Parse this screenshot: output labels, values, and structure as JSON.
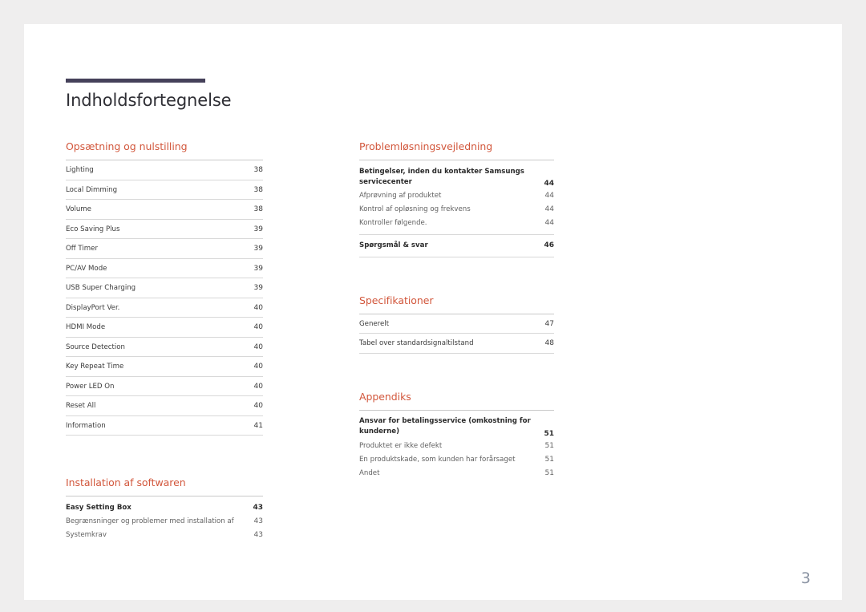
{
  "document": {
    "title": "Indholdsfortegnelse",
    "page_number": "3",
    "accent_color": "#d2573c",
    "rule_color": "#45415a"
  },
  "left_column": {
    "sections": [
      {
        "heading": "Opsætning og nulstilling",
        "entries": [
          {
            "label": "Lighting",
            "page": "38"
          },
          {
            "label": "Local Dimming",
            "page": "38"
          },
          {
            "label": "Volume",
            "page": "38"
          },
          {
            "label": "Eco Saving Plus",
            "page": "39"
          },
          {
            "label": "Off Timer",
            "page": "39"
          },
          {
            "label": "PC/AV Mode",
            "page": "39"
          },
          {
            "label": "USB Super Charging",
            "page": "39"
          },
          {
            "label": "DisplayPort Ver.",
            "page": "40"
          },
          {
            "label": "HDMI Mode",
            "page": "40"
          },
          {
            "label": "Source Detection",
            "page": "40"
          },
          {
            "label": "Key Repeat Time",
            "page": "40"
          },
          {
            "label": "Power LED On",
            "page": "40"
          },
          {
            "label": "Reset All",
            "page": "40"
          },
          {
            "label": "Information",
            "page": "41"
          }
        ]
      },
      {
        "heading": "Installation af softwaren",
        "entries": [
          {
            "label": "Easy Setting Box",
            "page": "43"
          },
          {
            "label": "Begrænsninger og problemer med installation af",
            "page": "43"
          },
          {
            "label": "Systemkrav",
            "page": "43"
          }
        ]
      }
    ]
  },
  "right_column": {
    "sections": [
      {
        "heading": "Problemløsningsvejledning",
        "entries": [
          {
            "label": "Betingelser, inden du kontakter Samsungs servicecenter",
            "page": "44"
          },
          {
            "label": "Afprøvning af produktet",
            "page": "44"
          },
          {
            "label": "Kontrol af opløsning og frekvens",
            "page": "44"
          },
          {
            "label": "Kontroller følgende.",
            "page": "44"
          },
          {
            "label": "Spørgsmål & svar",
            "page": "46"
          }
        ]
      },
      {
        "heading": "Specifikationer",
        "entries": [
          {
            "label": "Generelt",
            "page": "47"
          },
          {
            "label": "Tabel over standardsignaltilstand",
            "page": "48"
          }
        ]
      },
      {
        "heading": "Appendiks",
        "entries": [
          {
            "label": "Ansvar for betalingsservice (omkostning for kunderne)",
            "page": "51"
          },
          {
            "label": "Produktet er ikke defekt",
            "page": "51"
          },
          {
            "label": "En produktskade, som kunden har forårsaget",
            "page": "51"
          },
          {
            "label": "Andet",
            "page": "51"
          }
        ]
      }
    ]
  }
}
